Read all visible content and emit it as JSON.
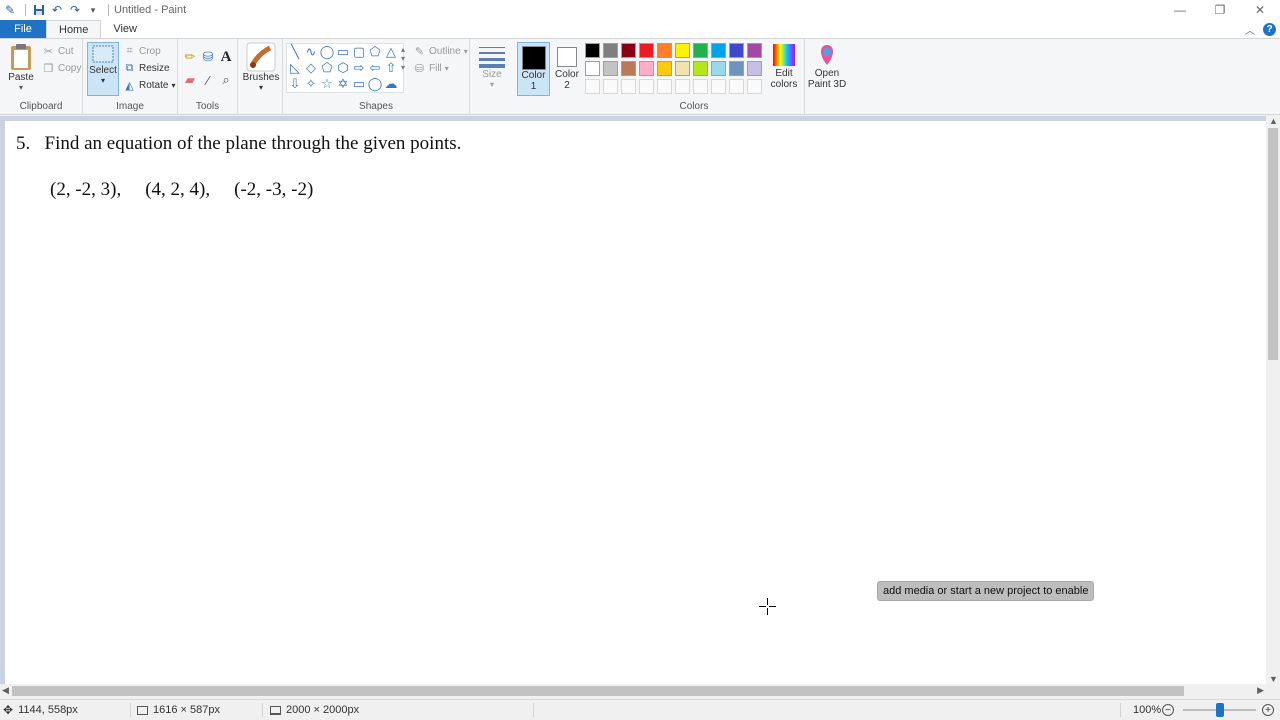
{
  "window": {
    "title": "Untitled - Paint",
    "menu_indicator": "▾"
  },
  "tabs": {
    "file": "File",
    "home": "Home",
    "view": "View"
  },
  "ribbon": {
    "clipboard": {
      "label": "Clipboard",
      "paste": "Paste",
      "cut": "Cut",
      "copy": "Copy"
    },
    "image": {
      "label": "Image",
      "select": "Select",
      "crop": "Crop",
      "resize": "Resize",
      "rotate": "Rotate"
    },
    "tools": {
      "label": "Tools"
    },
    "brushes": {
      "label": "Brushes"
    },
    "shapes": {
      "label": "Shapes",
      "outline": "Outline",
      "fill": "Fill"
    },
    "size": {
      "label": "Size"
    },
    "color1": {
      "label_line1": "Color",
      "label_line2": "1",
      "value": "#000000"
    },
    "color2": {
      "label_line1": "Color",
      "label_line2": "2",
      "value": "#ffffff"
    },
    "colors": {
      "label": "Colors",
      "row1": [
        "#000000",
        "#7f7f7f",
        "#880015",
        "#ed1c24",
        "#ff7f27",
        "#fff200",
        "#22b14c",
        "#00a2e8",
        "#3f48cc",
        "#a349a4"
      ],
      "row2": [
        "#ffffff",
        "#c3c3c3",
        "#b97a57",
        "#ffaec9",
        "#ffc90e",
        "#efe4b0",
        "#b5e61d",
        "#99d9ea",
        "#7092be",
        "#c8bfe7"
      ],
      "edit_line1": "Edit",
      "edit_line2": "colors"
    },
    "paint3d": {
      "label_line1": "Open",
      "label_line2": "Paint 3D"
    }
  },
  "canvas": {
    "question": "5.   Find an equation of the plane through the given points.",
    "points": [
      "(2, -2, 3),",
      "(4, 2, 4),",
      "(-2, -3, -2)"
    ],
    "tooltip": "add media or start a new project to enable"
  },
  "status": {
    "cursor_pos": "1144, 558px",
    "selection_size": "1616 × 587px",
    "image_size": "2000 × 2000px",
    "zoom": "100%",
    "zoom_fraction": 0.5
  }
}
